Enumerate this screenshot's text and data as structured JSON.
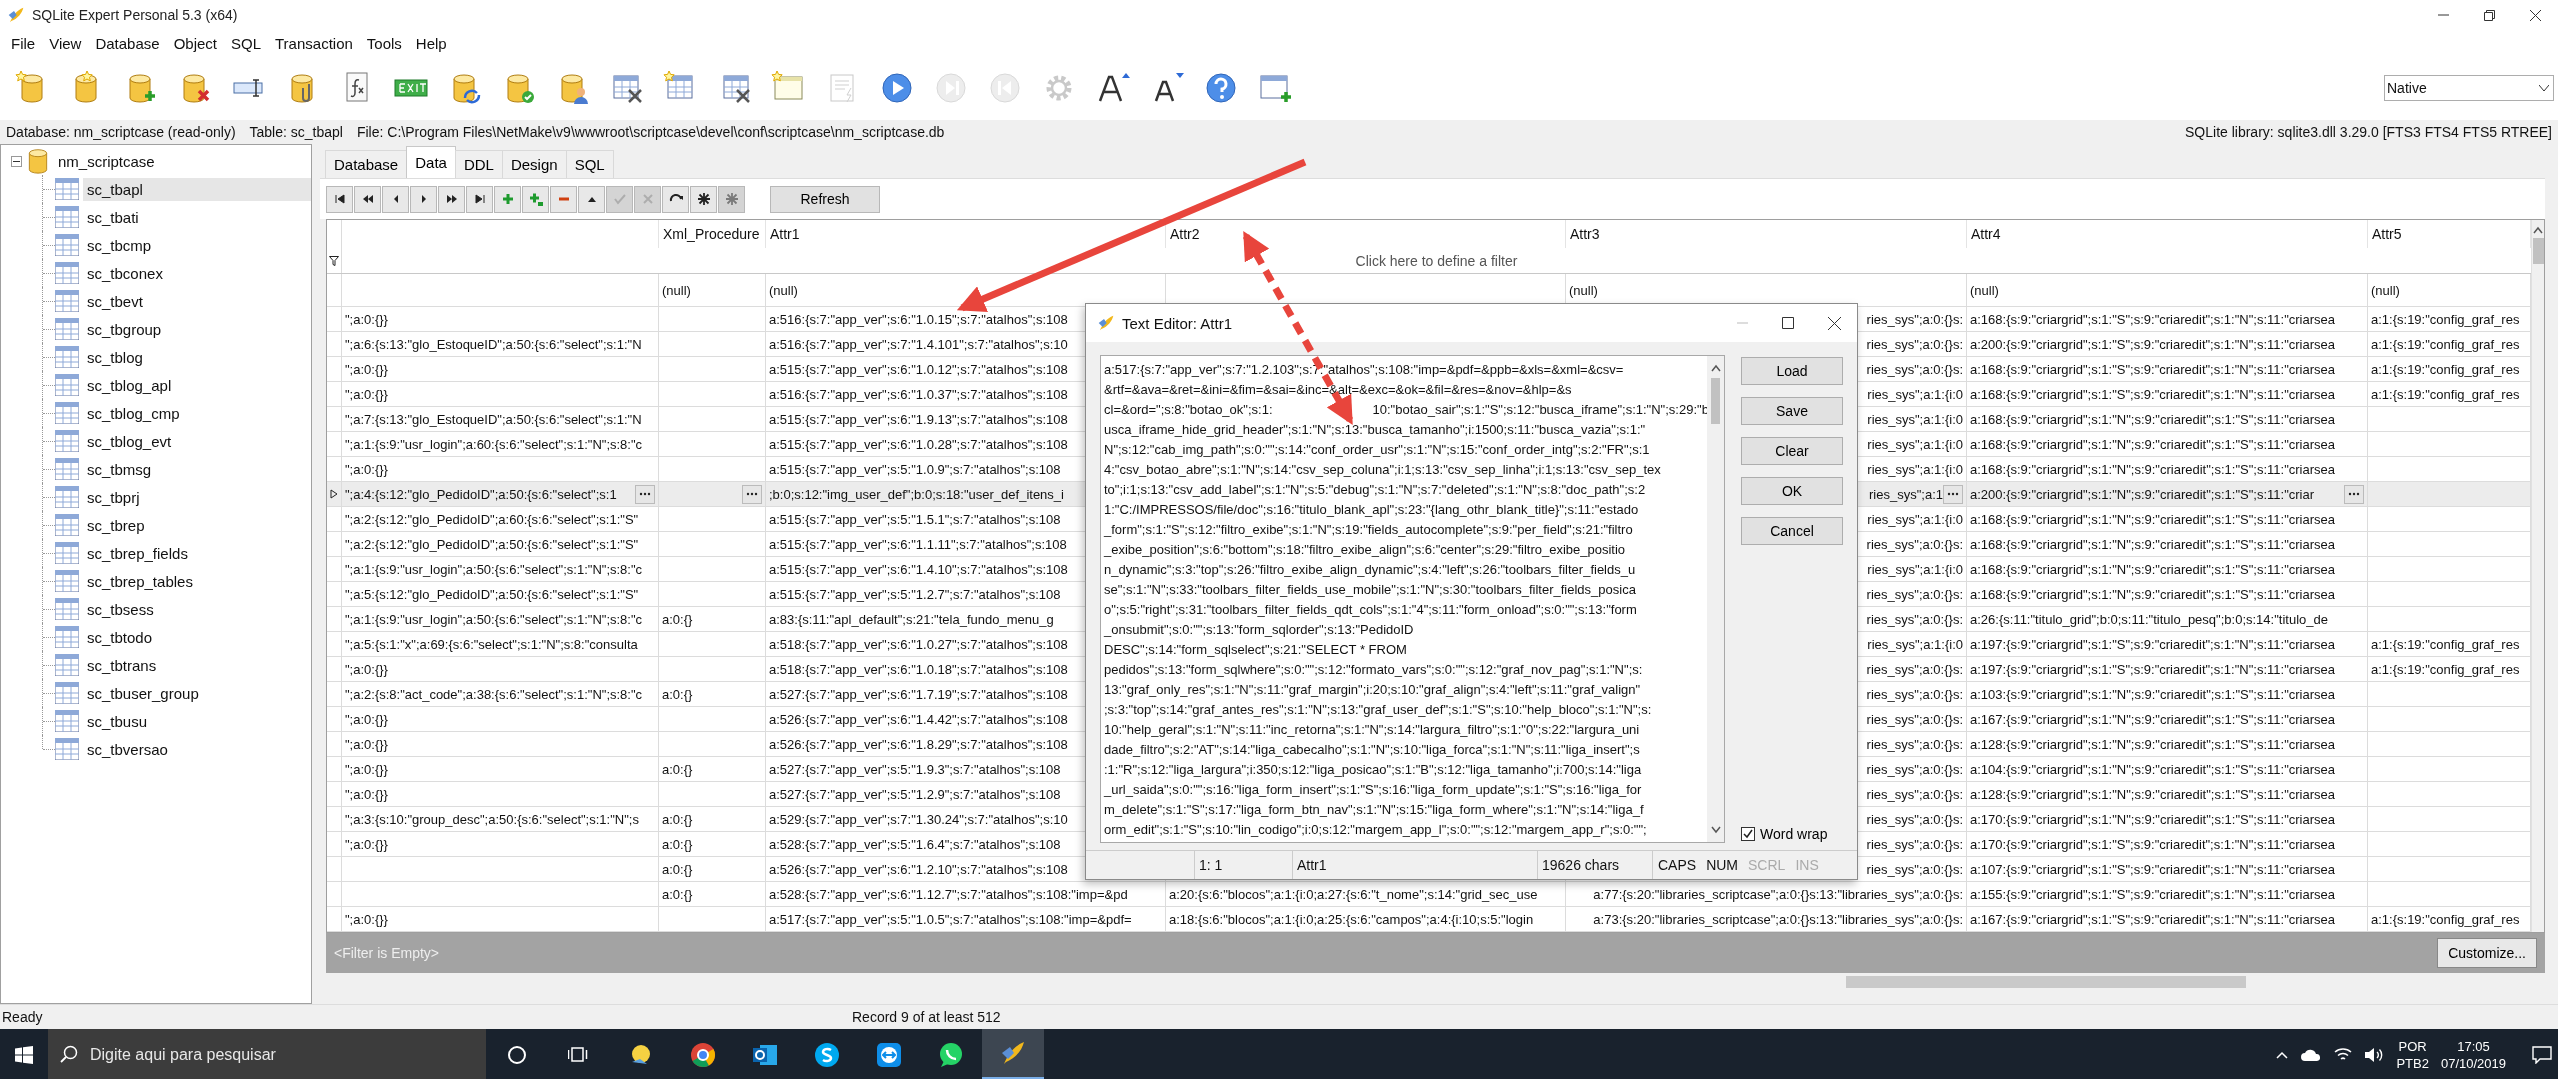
{
  "window": {
    "title": "SQLite Expert Personal 5.3 (x64)"
  },
  "menu": [
    "File",
    "View",
    "Database",
    "Object",
    "SQL",
    "Transaction",
    "Tools",
    "Help"
  ],
  "toolbar": {
    "buttons": [
      {
        "kind": "db_star",
        "disabled": false
      },
      {
        "kind": "db_star_alt",
        "disabled": false
      },
      {
        "kind": "db_add",
        "disabled": false
      },
      {
        "kind": "db_remove",
        "disabled": false
      },
      {
        "kind": "rename",
        "disabled": false
      },
      {
        "kind": "db_attach",
        "disabled": false
      },
      {
        "kind": "function",
        "disabled": false
      },
      {
        "kind": "exit",
        "disabled": false
      },
      {
        "kind": "db_sync",
        "disabled": false
      },
      {
        "kind": "db_check",
        "disabled": false
      },
      {
        "kind": "db_user",
        "disabled": false
      },
      {
        "kind": "table_tools",
        "disabled": false
      },
      {
        "kind": "table_new",
        "disabled": false
      },
      {
        "kind": "table_edit",
        "disabled": false
      },
      {
        "kind": "view_new",
        "disabled": false
      },
      {
        "kind": "doc_run",
        "disabled": true
      },
      {
        "kind": "play",
        "disabled": false
      },
      {
        "kind": "step_forward",
        "disabled": true
      },
      {
        "kind": "step_back",
        "disabled": true
      },
      {
        "kind": "settings",
        "disabled": true
      },
      {
        "kind": "font_up",
        "disabled": false
      },
      {
        "kind": "font_down",
        "disabled": false
      },
      {
        "kind": "help",
        "disabled": false
      },
      {
        "kind": "window_add",
        "disabled": false
      }
    ],
    "engine": "Native"
  },
  "info_bar": {
    "database": "Database: nm_scriptcase (read-only)",
    "table": "Table: sc_tbapl",
    "file": "File: C:\\Program Files\\NetMake\\v9\\wwwroot\\scriptcase\\devel\\conf\\scriptcase\\nm_scriptcase.db",
    "library": "SQLite library: sqlite3.dll 3.29.0 [FTS3 FTS4 FTS5 RTREE]"
  },
  "tree": {
    "label": "nm_scriptcase",
    "expanded": true,
    "children": [
      {
        "label": "sc_tbapl",
        "selected": true
      },
      {
        "label": "sc_tbati",
        "selected": false
      },
      {
        "label": "sc_tbcmp",
        "selected": false
      },
      {
        "label": "sc_tbconex",
        "selected": false
      },
      {
        "label": "sc_tbevt",
        "selected": false
      },
      {
        "label": "sc_tbgroup",
        "selected": false
      },
      {
        "label": "sc_tblog",
        "selected": false
      },
      {
        "label": "sc_tblog_apl",
        "selected": false
      },
      {
        "label": "sc_tblog_cmp",
        "selected": false
      },
      {
        "label": "sc_tblog_evt",
        "selected": false
      },
      {
        "label": "sc_tbmsg",
        "selected": false
      },
      {
        "label": "sc_tbprj",
        "selected": false
      },
      {
        "label": "sc_tbrep",
        "selected": false
      },
      {
        "label": "sc_tbrep_fields",
        "selected": false
      },
      {
        "label": "sc_tbrep_tables",
        "selected": false
      },
      {
        "label": "sc_tbsess",
        "selected": false
      },
      {
        "label": "sc_tbtodo",
        "selected": false
      },
      {
        "label": "sc_tbtrans",
        "selected": false
      },
      {
        "label": "sc_tbuser_group",
        "selected": false
      },
      {
        "label": "sc_tbusu",
        "selected": false
      },
      {
        "label": "sc_tbversao",
        "selected": false
      }
    ]
  },
  "tabs": [
    {
      "label": "Database",
      "selected": false
    },
    {
      "label": "Data",
      "selected": true
    },
    {
      "label": "DDL",
      "selected": false
    },
    {
      "label": "Design",
      "selected": false
    },
    {
      "label": "SQL",
      "selected": false
    }
  ],
  "grid_toolbar": {
    "buttons": [
      {
        "kind": "first",
        "disabled": false
      },
      {
        "kind": "prior_page",
        "disabled": false
      },
      {
        "kind": "prior",
        "disabled": false
      },
      {
        "kind": "next",
        "disabled": false
      },
      {
        "kind": "next_page",
        "disabled": false
      },
      {
        "kind": "last",
        "disabled": false
      },
      {
        "kind": "insert",
        "disabled": false
      },
      {
        "kind": "append",
        "disabled": false
      },
      {
        "kind": "delete",
        "disabled": false
      },
      {
        "kind": "edit",
        "disabled": false
      },
      {
        "kind": "post",
        "disabled": true
      },
      {
        "kind": "cancel",
        "disabled": true
      },
      {
        "kind": "refresh",
        "disabled": false
      },
      {
        "kind": "set_null",
        "disabled": false
      },
      {
        "kind": "set_null",
        "disabled": true
      }
    ],
    "refresh": "Refresh"
  },
  "grid": {
    "columns": [
      "Xml_Procedure",
      "Attr1",
      "Attr2",
      "Attr3",
      "Attr4",
      "Attr5"
    ],
    "filter_hint": "Click here to define a filter",
    "null_row": {
      "xml_procedure": "(null)",
      "attr1": "(null)",
      "attr3": "(null)",
      "attr4": "(null)",
      "attr5": "(null)"
    },
    "rows": [
      {
        "selected": false,
        "cells": {
          "column_1": "\";a:0:{}}",
          "attr1": "a:516:{s:7:\"app_ver\";s:6:\"1.0.15\";s:7:\"atalhos\";s:108",
          "attr3": "ries_sys\";a:0:{}s:",
          "attr4": "a:168:{s:9:\"criargrid\";s:1:\"S\";s:9:\"criaredit\";s:1:\"N\";s:11:\"criarsea",
          "attr5": "a:1:{s:19:\"config_graf_res"
        }
      },
      {
        "selected": false,
        "cells": {
          "column_1": "\";a:6:{s:13:\"glo_EstoqueID\";a:50:{s:6:\"select\";s:1:\"N",
          "attr1": "a:516:{s:7:\"app_ver\";s:7:\"1.4.101\";s:7:\"atalhos\";s:10",
          "attr3": "ries_sys\";a:0:{}s:",
          "attr4": "a:200:{s:9:\"criargrid\";s:1:\"S\";s:9:\"criaredit\";s:1:\"N\";s:11:\"criarsea",
          "attr5": "a:1:{s:19:\"config_graf_res"
        }
      },
      {
        "selected": false,
        "cells": {
          "column_1": "\";a:0:{}}",
          "attr1": "a:515:{s:7:\"app_ver\";s:6:\"1.0.12\";s:7:\"atalhos\";s:108",
          "attr3": "ries_sys\";a:0:{}s:",
          "attr4": "a:168:{s:9:\"criargrid\";s:1:\"S\";s:9:\"criaredit\";s:1:\"N\";s:11:\"criarsea",
          "attr5": "a:1:{s:19:\"config_graf_res"
        }
      },
      {
        "selected": false,
        "cells": {
          "column_1": "\";a:0:{}}",
          "attr1": "a:516:{s:7:\"app_ver\";s:6:\"1.0.37\";s:7:\"atalhos\";s:108",
          "attr3": "ries_sys\";a:1:{i:0",
          "attr4": "a:168:{s:9:\"criargrid\";s:1:\"S\";s:9:\"criaredit\";s:1:\"N\";s:11:\"criarsea",
          "attr5": "a:1:{s:19:\"config_graf_res"
        }
      },
      {
        "selected": false,
        "cells": {
          "column_1": "\";a:7:{s:13:\"glo_EstoqueID\";a:50:{s:6:\"select\";s:1:\"N",
          "attr1": "a:515:{s:7:\"app_ver\";s:6:\"1.9.13\";s:7:\"atalhos\";s:108",
          "attr3": "ries_sys\";a:1:{i:0",
          "attr4": "a:168:{s:9:\"criargrid\";s:1:\"N\";s:9:\"criaredit\";s:1:\"S\";s:11:\"criarsea"
        }
      },
      {
        "selected": false,
        "cells": {
          "column_1": "\";a:1:{s:9:\"usr_login\";a:60:{s:6:\"select\";s:1:\"N\";s:8:\"c",
          "attr1": "a:515:{s:7:\"app_ver\";s:6:\"1.0.28\";s:7:\"atalhos\";s:108",
          "attr3": "ries_sys\";a:1:{i:0",
          "attr4": "a:168:{s:9:\"criargrid\";s:1:\"N\";s:9:\"criaredit\";s:1:\"S\";s:11:\"criarsea"
        }
      },
      {
        "selected": false,
        "cells": {
          "column_1": "\";a:0:{}}",
          "attr1": "a:515:{s:7:\"app_ver\";s:5:\"1.0.9\";s:7:\"atalhos\";s:108",
          "attr3": "ries_sys\";a:1:{i:0",
          "attr4": "a:168:{s:9:\"criargrid\";s:1:\"N\";s:9:\"criaredit\";s:1:\"S\";s:11:\"criarsea"
        }
      },
      {
        "selected": true,
        "cells": {
          "column_1": "\";a:4:{s:12:\"glo_PedidoID\";a:50:{s:6:\"select\";s:1",
          "attr1": ";b:0;s:12:\"img_user_def\";b:0;s:18:\"user_def_itens_i",
          "attr3": "ries_sys\";a:1",
          "attr4": "a:200:{s:9:\"criargrid\";s:1:\"N\";s:9:\"criaredit\";s:1:\"S\";s:11:\"criar"
        }
      },
      {
        "selected": false,
        "cells": {
          "column_1": "\";a:2:{s:12:\"glo_PedidoID\";a:60:{s:6:\"select\";s:1:\"S\"",
          "attr1": "a:515:{s:7:\"app_ver\";s:5:\"1.5.1\";s:7:\"atalhos\";s:108",
          "attr3": "ries_sys\";a:1:{i:0",
          "attr4": "a:168:{s:9:\"criargrid\";s:1:\"N\";s:9:\"criaredit\";s:1:\"S\";s:11:\"criarsea"
        }
      },
      {
        "selected": false,
        "cells": {
          "column_1": "\";a:2:{s:12:\"glo_PedidoID\";a:50:{s:6:\"select\";s:1:\"S\"",
          "attr1": "a:515:{s:7:\"app_ver\";s:6:\"1.1.11\";s:7:\"atalhos\";s:108",
          "attr3": "ries_sys\";a:0:{}s:",
          "attr4": "a:168:{s:9:\"criargrid\";s:1:\"N\";s:9:\"criaredit\";s:1:\"S\";s:11:\"criarsea"
        }
      },
      {
        "selected": false,
        "cells": {
          "column_1": "\";a:1:{s:9:\"usr_login\";a:50:{s:6:\"select\";s:1:\"N\";s:8:\"c",
          "attr1": "a:515:{s:7:\"app_ver\";s:6:\"1.4.10\";s:7:\"atalhos\";s:108",
          "attr3": "ries_sys\";a:1:{i:0",
          "attr4": "a:168:{s:9:\"criargrid\";s:1:\"N\";s:9:\"criaredit\";s:1:\"S\";s:11:\"criarsea"
        }
      },
      {
        "selected": false,
        "cells": {
          "column_1": "\";a:5:{s:12:\"glo_PedidoID\";a:50:{s:6:\"select\";s:1:\"S\"",
          "attr1": "a:515:{s:7:\"app_ver\";s:5:\"1.2.7\";s:7:\"atalhos\";s:108",
          "attr3": "ries_sys\";a:0:{}s:",
          "attr4": "a:168:{s:9:\"criargrid\";s:1:\"N\";s:9:\"criaredit\";s:1:\"S\";s:11:\"criarsea"
        }
      },
      {
        "selected": false,
        "cells": {
          "column_1": "\";a:1:{s:9:\"usr_login\";a:50:{s:6:\"select\";s:1:\"N\";s:8:\"c",
          "xml_procedure": "a:0:{}",
          "attr1": "a:83:{s:11:\"apl_default\";s:21:\"tela_fundo_menu_g",
          "attr3": "ries_sys\";a:0:{}s:",
          "attr4": "a:26:{s:11:\"titulo_grid\";b:0;s:11:\"titulo_pesq\";b:0;s:14:\"titulo_de"
        }
      },
      {
        "selected": false,
        "cells": {
          "column_1": "\";a:5:{s:1:\"x\";a:69:{s:6:\"select\";s:1:\"N\";s:8:\"consulta",
          "attr1": "a:518:{s:7:\"app_ver\";s:6:\"1.0.27\";s:7:\"atalhos\";s:108",
          "attr3": "ries_sys\";a:1:{i:0",
          "attr4": "a:197:{s:9:\"criargrid\";s:1:\"S\";s:9:\"criaredit\";s:1:\"N\";s:11:\"criarsea",
          "attr5": "a:1:{s:19:\"config_graf_res"
        }
      },
      {
        "selected": false,
        "cells": {
          "column_1": "\";a:0:{}}",
          "attr1": "a:518:{s:7:\"app_ver\";s:6:\"1.0.18\";s:7:\"atalhos\";s:108",
          "attr3": "ries_sys\";a:0:{}s:",
          "attr4": "a:197:{s:9:\"criargrid\";s:1:\"S\";s:9:\"criaredit\";s:1:\"N\";s:11:\"criarsea",
          "attr5": "a:1:{s:19:\"config_graf_res"
        }
      },
      {
        "selected": false,
        "cells": {
          "column_1": "\";a:2:{s:8:\"act_code\";a:38:{s:6:\"select\";s:1:\"N\";s:8:\"c",
          "xml_procedure": "a:0:{}",
          "attr1": "a:527:{s:7:\"app_ver\";s:6:\"1.7.19\";s:7:\"atalhos\";s:108",
          "attr3": "ries_sys\";a:0:{}s:",
          "attr4": "a:103:{s:9:\"criargrid\";s:1:\"N\";s:9:\"criaredit\";s:1:\"S\";s:11:\"criarsea"
        }
      },
      {
        "selected": false,
        "cells": {
          "column_1": "\";a:0:{}}",
          "attr1": "a:526:{s:7:\"app_ver\";s:6:\"1.4.42\";s:7:\"atalhos\";s:108",
          "attr3": "ries_sys\";a:0:{}s:",
          "attr4": "a:167:{s:9:\"criargrid\";s:1:\"N\";s:9:\"criaredit\";s:1:\"S\";s:11:\"criarsea"
        }
      },
      {
        "selected": false,
        "cells": {
          "column_1": "\";a:0:{}}",
          "attr1": "a:526:{s:7:\"app_ver\";s:6:\"1.8.29\";s:7:\"atalhos\";s:108",
          "attr3": "ries_sys\";a:0:{}s:",
          "attr4": "a:128:{s:9:\"criargrid\";s:1:\"N\";s:9:\"criaredit\";s:1:\"S\";s:11:\"criarsea"
        }
      },
      {
        "selected": false,
        "cells": {
          "column_1": "\";a:0:{}}",
          "xml_procedure": "a:0:{}",
          "attr1": "a:527:{s:7:\"app_ver\";s:5:\"1.9.3\";s:7:\"atalhos\";s:108",
          "attr3": "ries_sys\";a:0:{}s:",
          "attr4": "a:104:{s:9:\"criargrid\";s:1:\"N\";s:9:\"criaredit\";s:1:\"S\";s:11:\"criarsea"
        }
      },
      {
        "selected": false,
        "cells": {
          "column_1": "\";a:0:{}}",
          "attr1": "a:527:{s:7:\"app_ver\";s:5:\"1.2.9\";s:7:\"atalhos\";s:108",
          "attr3": "ries_sys\";a:0:{}s:",
          "attr4": "a:128:{s:9:\"criargrid\";s:1:\"N\";s:9:\"criaredit\";s:1:\"S\";s:11:\"criarsea"
        }
      },
      {
        "selected": false,
        "cells": {
          "column_1": "\";a:3:{s:10:\"group_desc\";a:50:{s:6:\"select\";s:1:\"N\";s",
          "xml_procedure": "a:0:{}",
          "attr1": "a:529:{s:7:\"app_ver\";s:7:\"1.30.24\";s:7:\"atalhos\";s:10",
          "attr3": "ries_sys\";a:0:{}s:",
          "attr4": "a:170:{s:9:\"criargrid\";s:1:\"N\";s:9:\"criaredit\";s:1:\"S\";s:11:\"criarsea"
        }
      },
      {
        "selected": false,
        "cells": {
          "column_1": "\";a:0:{}}",
          "xml_procedure": "a:0:{}",
          "attr1": "a:528:{s:7:\"app_ver\";s:5:\"1.6.4\";s:7:\"atalhos\";s:108",
          "attr3": "ries_sys\";a:0:{}s:",
          "attr4": "a:170:{s:9:\"criargrid\";s:1:\"S\";s:9:\"criaredit\";s:1:\"N\";s:11:\"criarsea"
        }
      },
      {
        "selected": false,
        "cells": {
          "xml_procedure": "a:0:{}",
          "attr1": "a:526:{s:7:\"app_ver\";s:6:\"1.2.10\";s:7:\"atalhos\";s:108",
          "attr3": "ries_sys\";a:0:{}s:",
          "attr4": "a:107:{s:9:\"criargrid\";s:1:\"S\";s:9:\"criaredit\";s:1:\"N\";s:11:\"criarsea"
        }
      },
      {
        "selected": false,
        "cells": {
          "xml_procedure": "a:0:{}",
          "attr1": "a:528:{s:7:\"app_ver\";s:6:\"1.12.7\";s:7:\"atalhos\";s:108:\"imp=&pd",
          "attr2": "a:20:{s:6:\"blocos\";a:1:{i:0;a:27:{s:6:\"t_nome\";s:14:\"grid_sec_use",
          "attr3": "a:77:{s:20:\"libraries_scriptcase\";a:0:{}s:13:\"libraries_sys\";a:0:{}s:",
          "attr4": "a:155:{s:9:\"criargrid\";s:1:\"S\";s:9:\"criaredit\";s:1:\"N\";s:11:\"criarsea"
        }
      },
      {
        "selected": false,
        "cells": {
          "column_1": "\";a:0:{}}",
          "attr1": "a:517:{s:7:\"app_ver\";s:5:\"1.0.5\";s:7:\"atalhos\";s:108:\"imp=&pdf=",
          "attr2": "a:18:{s:6:\"blocos\";a:1:{i:0;a:25:{s:6:\"campos\";a:4:{i:10;s:5:\"login",
          "attr3": "a:73:{s:20:\"libraries_scriptcase\";a:0:{}s:13:\"libraries_sys\";a:0:{}s:",
          "attr4": "a:167:{s:9:\"criargrid\";s:1:\"S\";s:9:\"criaredit\";s:1:\"N\";s:11:\"criarsea",
          "attr5": "a:1:{s:19:\"config_graf_res"
        }
      }
    ]
  },
  "filter_bar": {
    "text": "<Filter is Empty>",
    "button": "Customize..."
  },
  "status_bar": {
    "state": "Ready",
    "record": "Record 9 of at least 512"
  },
  "editor": {
    "title": "Text Editor: Attr1",
    "lines": [
      "a:517:{s:7:\"app_ver\";s:7:\"1.2.103\";s:7:\"atalhos\";s:108:\"imp=&pdf=&ppb=&xls=&xml=&csv=",
      "&rtf=&ava=&ret=&ini=&fim=&sai=&inc=&alt=&exc=&ok=&fil=&res=&nov=&hlp=&s",
      [
        "cl=&ord=\";s:8:\"botao_ok\";s:1:",
        "10:\"botao_sair\";s:1:\"S\";s:12:\"busca_iframe\";s:1:\"N\";s:29:\"b"
      ],
      "usca_iframe_hide_grid_header\";s:1:\"N\";s:13:\"busca_tamanho\";i:1500;s:11:\"busca_vazia\";s:1:\"",
      "N\";s:12:\"cab_img_path\";s:0:\"\";s:14:\"conf_order_usr\";s:1:\"N\";s:15:\"conf_order_intg\";s:2:\"FR\";s:1",
      "4:\"csv_botao_abre\";s:1:\"N\";s:14:\"csv_sep_coluna\";i:1;s:13:\"csv_sep_linha\";i:1;s:13:\"csv_sep_tex",
      "to\";i:1;s:13:\"csv_add_label\";s:1:\"N\";s:5:\"debug\";s:1:\"N\";s:7:\"deleted\";s:1:\"N\";s:8:\"doc_path\";s:2",
      "1:\"C:/IMPRESSOS/file/doc\";s:16:\"titulo_blank_apl\";s:23:\"{lang_othr_blank_title}\";s:11:\"estado",
      "_form\";s:1:\"S\";s:12:\"filtro_exibe\";s:1:\"N\";s:19:\"fields_autocomplete\";s:9:\"per_field\";s:21:\"filtro",
      "_exibe_position\";s:6:\"bottom\";s:18:\"filtro_exibe_align\";s:6:\"center\";s:29:\"filtro_exibe_positio",
      "n_dynamic\";s:3:\"top\";s:26:\"filtro_exibe_align_dynamic\";s:4:\"left\";s:26:\"toolbars_filter_fields_u",
      "se\";s:1:\"N\";s:33:\"toolbars_filter_fields_use_mobile\";s:1:\"N\";s:30:\"toolbars_filter_fields_posica",
      "o\";s:5:\"right\";s:31:\"toolbars_filter_fields_qdt_cols\";s:1:\"4\";s:11:\"form_onload\";s:0:\"\";s:13:\"form",
      "_onsubmit\";s:0:\"\";s:13:\"form_sqlorder\";s:13:\"PedidoID",
      "DESC\";s:14:\"form_sqlselect\";s:21:\"SELECT * FROM",
      "pedidos\";s:13:\"form_sqlwhere\";s:0:\"\";s:12:\"formato_vars\";s:0:\"\";s:12:\"graf_nov_pag\";s:1:\"N\";s:",
      "13:\"graf_only_res\";s:1:\"N\";s:11:\"graf_margin\";i:20;s:10:\"graf_align\";s:4:\"left\";s:11:\"graf_valign\"",
      ";s:3:\"top\";s:14:\"graf_antes_res\";s:1:\"N\";s:13:\"graf_user_def\";s:1:\"S\";s:10:\"help_bloco\";s:1:\"N\";s:",
      "10:\"help_geral\";s:1:\"N\";s:11:\"inc_retorna\";s:1:\"N\";s:14:\"largura_filtro\";s:1:\"0\";s:22:\"largura_uni",
      "dade_filtro\";s:2:\"AT\";s:14:\"liga_cabecalho\";s:1:\"N\";s:10:\"liga_forca\";s:1:\"N\";s:11:\"liga_insert\";s",
      ":1:\"R\";s:12:\"liga_largura\";i:350;s:12:\"liga_posicao\";s:1:\"B\";s:12:\"liga_tamanho\";i:700;s:14:\"liga",
      "_url_saida\";s:0:\"\";s:16:\"liga_form_insert\";s:1:\"S\";s:16:\"liga_form_update\";s:1:\"S\";s:16:\"liga_for",
      "m_delete\";s:1:\"S\";s:17:\"liga_form_btn_nav\";s:1:\"N\";s:15:\"liga_form_where\";s:1:\"N\";s:14:\"liga_f",
      "orm_edit\";s:1:\"S\";s:10:\"lin_codigo\";i:0;s:12:\"margem_app_l\";s:0:\"\";s:12:\"margem_app_r\";s:0:\"\";"
    ],
    "buttons": [
      "Load",
      "Save",
      "Clear",
      "OK",
      "Cancel"
    ],
    "word_wrap": {
      "label": "Word wrap",
      "checked": true
    },
    "status": {
      "position": "1: 1",
      "column": "Attr1",
      "length": "19626 chars",
      "keys": [
        {
          "label": "CAPS",
          "on": true
        },
        {
          "label": "NUM",
          "on": true
        },
        {
          "label": "SCRL",
          "on": false
        },
        {
          "label": "INS",
          "on": false
        }
      ]
    }
  },
  "taskbar": {
    "search_placeholder": "Digite aqui para pesquisar",
    "apps": [
      {
        "kind": "bulb",
        "active": false
      },
      {
        "kind": "browser",
        "active": false
      },
      {
        "kind": "mail",
        "active": false
      },
      {
        "kind": "chat_blue",
        "active": false
      },
      {
        "kind": "remote",
        "active": false
      },
      {
        "kind": "chat_green",
        "active": false
      },
      {
        "kind": "feather",
        "active": true
      }
    ],
    "language": "POR",
    "layout": "PTB2",
    "time": "17:05",
    "date": "07/10/2019"
  }
}
